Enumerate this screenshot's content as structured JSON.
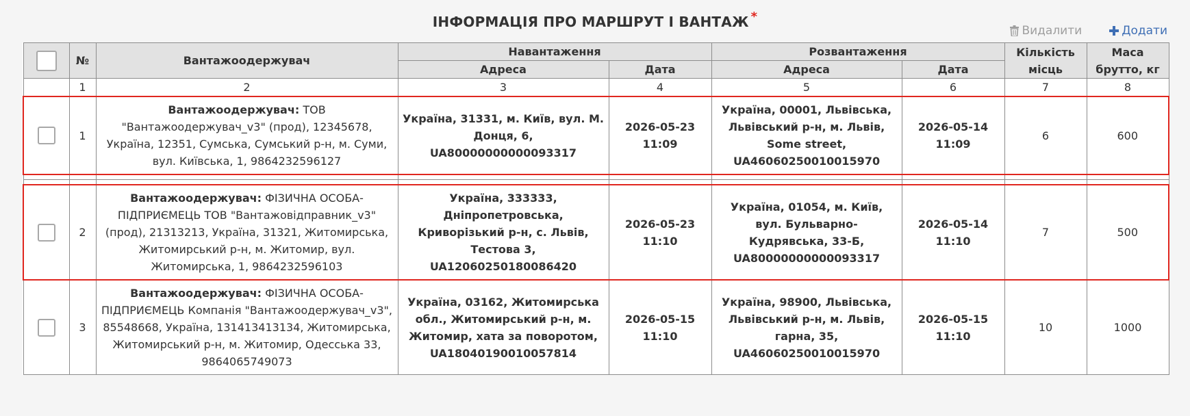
{
  "section": {
    "title": "ІНФОРМАЦІЯ ПРО МАРШРУТ І ВАНТАЖ",
    "required_mark": "*"
  },
  "actions": {
    "delete_label": "Видалити",
    "add_label": "Додати"
  },
  "table": {
    "headers": {
      "number": "№",
      "consignee": "Вантажоодержувач",
      "loading": "Навантаження",
      "unloading": "Розвантаження",
      "address": "Адреса",
      "date": "Дата",
      "places": "Кількість місць",
      "gross_mass": "Маса брутто, кг"
    },
    "column_numbers": [
      "1",
      "2",
      "3",
      "4",
      "5",
      "6",
      "7",
      "8"
    ],
    "rows": [
      {
        "index": "1",
        "consignee_label": "Вантажоодержувач:",
        "consignee": " ТОВ \"Вантажоодержувач_v3\" (прод), 12345678, Україна, 12351, Сумська, Сумський р-н, м. Суми, вул. Київська, 1, 9864232596127",
        "load_address": "Україна, 31331, м. Київ, вул. М. Донця, 6, UA80000000000093317",
        "load_date": "2026-05-23 11:09",
        "unload_address": "Україна, 00001, Львівська, Львівський р-н, м. Львів, Some street, UA46060250010015970",
        "unload_date": "2026-05-14 11:09",
        "places": "6",
        "mass": "600",
        "selected": true
      },
      {
        "index": "2",
        "consignee_label": "Вантажоодержувач:",
        "consignee": " ФІЗИЧНА ОСОБА-ПІДПРИЄМЕЦЬ ТОВ \"Вантажовідправник_v3\" (прод), 21313213, Україна, 31321, Житомирська, Житомирський р-н, м. Житомир, вул. Житомирська, 1, 9864232596103",
        "load_address": "Україна, 333333, Дніпропетровська, Криворізький р-н, с. Львів, Тестова 3, UA12060250180086420",
        "load_date": "2026-05-23 11:10",
        "unload_address": "Україна, 01054, м. Київ, вул. Бульварно-Кудрявська, 33-Б, UA80000000000093317",
        "unload_date": "2026-05-14 11:10",
        "places": "7",
        "mass": "500",
        "selected": true
      },
      {
        "index": "3",
        "consignee_label": "Вантажоодержувач:",
        "consignee": " ФІЗИЧНА ОСОБА-ПІДПРИЄМЕЦЬ Компанія \"Вантажоодержувач_v3\", 85548668, Україна, 131413413134, Житомирська, Житомирський р-н, м. Житомир, Одесська 33, 9864065749073",
        "load_address": "Україна, 03162, Житомирська обл., Житомирський р-н, м. Житомир, хата за поворотом, UA18040190010057814",
        "load_date": "2026-05-15 11:10",
        "unload_address": "Україна, 98900, Львівська, Львівський р-н, м. Львів, гарна, 35, UA46060250010015970",
        "unload_date": "2026-05-15 11:10",
        "places": "10",
        "mass": "1000",
        "selected": false
      }
    ]
  },
  "colors": {
    "accent": "#3f6fb5",
    "required": "#e0261f",
    "selection_border": "#e0261f",
    "header_bg": "#e2e2e2"
  },
  "icons": {
    "delete": "trash-icon",
    "add": "plus-icon"
  }
}
